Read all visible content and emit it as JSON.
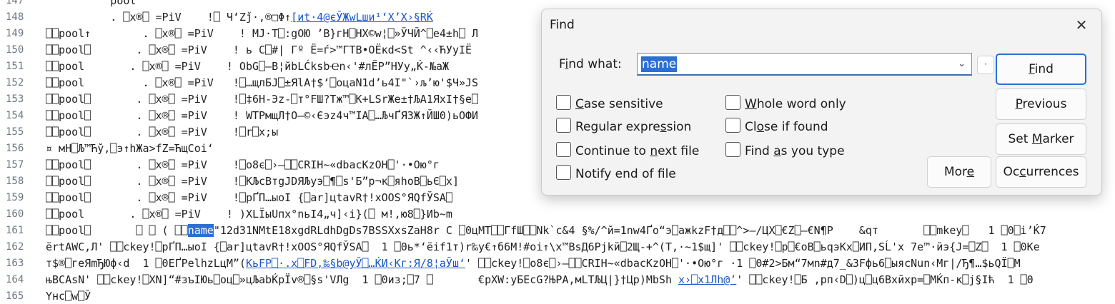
{
  "editor": {
    "lines": [
      {
        "n": "147",
        "pre": "          pool"
      },
      {
        "n": "148",
        "pre": "          . ⎕x®⎕ =PiV    !⎕ Ч‘Zǰ·,®□Φ↑",
        "link": "[иt·4@єЎЖwLши¹‘X’X›§RЌ"
      },
      {
        "n": "149",
        "pre": "⎕⎕pool↑        . ⎕x®⎕ =PiV    ! MJ·T⎕:gOЮ ’B}гH⎕HX©w¦⎕»ЎЧЙ^⎕е4±h⎕ Л"
      },
      {
        "n": "150",
        "pre": "⎕⎕pool⎕       . ⎕x®⎕ =PiV    ! ь C⎕#| Гº Ё=ѓ>™ГTB•OЁкd<St ^‹‹ЋУyIЁ"
      },
      {
        "n": "151",
        "pre": "⎕⎕pool       . ⎕x®⎕ =PiV    ! ObG⎕–B¦йbLĆksbҼn‹'#лЁP”HУy„Ќ-№aЖ"
      },
      {
        "n": "152",
        "pre": "⎕⎕pool         . ⎕x®⎕ =PiV   !⎕…щлБЈ⎕±ЯlА†$‘⎕oцaN1d’ь4I\"`›љ’ю'$Ч»JS"
      },
      {
        "n": "153",
        "pre": "⎕⎕pool⎕       . ⎕x®⎕ =PiV    !⎕‡6H-Эz-⎕т°FШ?Тж™⎕K+LSrЖe±†ЉА1ЯxI†§e⎕"
      },
      {
        "n": "154",
        "pre": "⎕⎕pool⎕       . ⎕x®⎕ =PiV    ! WTPмщЛ†O–©‹Єэz4ч™IA⎕…ЉчҐЯ3Ж↑ЙШ0)ьOФИ"
      },
      {
        "n": "155",
        "pre": "⎕⎕pool⎕       . ⎕x®⎕ =PiV    !⎕r⎕x;ы"
      },
      {
        "n": "156",
        "pre": "¤ мH⎕Љ™Ћy̆,⎕э↑hЖa>fZ=ЋщCoi‘"
      },
      {
        "n": "157",
        "pre": "⎕⎕pool⎕       . ⎕x®⎕ =PiV    !⎕o8є⎕›–⎕⎕CRIH~«dbacKzOH⎕'·•Oю°г"
      },
      {
        "n": "158",
        "pre": "⎕⎕pool⎕       . ⎕x®⎕ =PiV    !⎕KЉcBтgJDЯЉуэ⎕¶⎕s'Б”р¬к⎕яhoВ⎕ьЄ⎕x]"
      },
      {
        "n": "159",
        "pre": "⎕⎕pool⎕       . ⎕x®⎕ =PiV    !⎕pҐП…ыoI {⎕ar]цtavR†!xOOS°ЯQfЎSA⎕"
      },
      {
        "n": "160",
        "pre": "⎕⎕pool       . ⎕x®⎕ =PiV    ! )XLЇыUпx°nьI4„ч]‹i}(⎕ м!,ю8⎕}Иb~m"
      },
      {
        "n": "161",
        "pre": "⎕⎕pool⎕       ⎕ ⎕ ( ⎕⎕",
        "hl": "name",
        "post": "\"12d31NMtE18xgdRLdhDgDs7BSSXxsZaH8r C ⎕0цMT⎕⎕ГfШ⎕⎕Nk`c&4 §%/^й=1nw4Ґo“э⎕aжkzF†д⎕⎕^>—/ЦX⎕€Z⎕–€N¶P    &qт       ⎕⎕mkey⎕   1 ⎕0⎕i’Ќ7"
      },
      {
        "n": "162",
        "pre": "ërtAWC,Л' ⎕⎕ckey!⎕pҐП…ыoI {⎕ar]цtavR†!xOOS°ЯQfЎSA⎕  1 ⎕0ь*‘ëif1т)r‰y€↑б6M!#оi↑\\x™BѕД6Pjkй⎕2Щ-+^(T,·~1$щ]' ⎕⎕ckey!⎕p⎕€oB⎕ьqэKх⎕ИП,SĹ'x 7e™·йэ{J=⎕Z⎕  1 ⎕0Ке"
      },
      {
        "n": "163",
        "pre": "т$®⎕гeЯmЂЮф‹d  1 ⎕0EҐPelhzLцM”(",
        "link": "KьFP⎕·.x⎕FD,‰§b@уЎ⎕…ЌИ‹Kг:Я/8¦aЎш‘",
        "post": "' ⎕⎕ckey!⎕o8є⎕›–⎕⎕CRIH~«dbacKzOH⎕'·•Oю°г ·1 ⎕0#2>Бм“7мn#д7_&3Fфь6⎕ыясNun‹Mг|/Ђ¶…$ьQÏ⎕M"
      },
      {
        "n": "164",
        "pre": "њBCAsN' ⎕⎕ckey!⎕XN]“#зъIЮь⎕oц⎕»цЉabЌpЇv®⎕§s'VЛg  1 ⎕0из;⎕7 ⎕       €pXW:уБEcG?ЊPA,мLTЉЦ|}†Цр)MbSh ",
        "link": "x›⎕х1Лh@’",
        "post": "' ⎕⎕ckey!⎕Б ,рп‹D⎕)ц⎕ц6Вxйxр=⎕MЌп-к⎕j§Iћ  1 ⎕0"
      },
      {
        "n": "165",
        "pre": "Yнc⎕w⎕Ў"
      }
    ]
  },
  "find": {
    "title": "Find",
    "find_what_label": "Find what:",
    "search_value": "name",
    "options": {
      "case_sensitive": "Case sensitive",
      "whole_word": "Whole word only",
      "regex": "Regular expression",
      "close_if_found": "Close if found",
      "continue_next_file": "Continue to next file",
      "find_as_you_type": "Find as you type",
      "notify_end": "Notify end of file"
    },
    "buttons": {
      "find": "Find",
      "previous": "Previous",
      "set_marker": "Set Marker",
      "more": "More",
      "occurrences": "Occurrences"
    }
  }
}
